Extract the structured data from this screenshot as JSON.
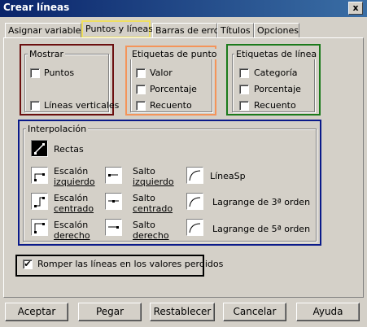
{
  "window": {
    "title": "Crear líneas",
    "close": "x"
  },
  "tabs": [
    "Asignar variables",
    "Puntos y líneas",
    "Barras de error",
    "Títulos",
    "Opciones"
  ],
  "mostrar": {
    "title": "Mostrar",
    "puntos": "Puntos",
    "lineas": "Líneas verticales"
  },
  "etiq_punto": {
    "title": "Etiquetas de punto",
    "valor": "Valor",
    "porcentaje": "Porcentaje",
    "recuento": "Recuento"
  },
  "etiq_linea": {
    "title": "Etiquetas de línea",
    "categoria": "Categoría",
    "porcentaje": "Porcentaje",
    "recuento": "Recuento"
  },
  "interp": {
    "title": "Interpolación",
    "rectas": "Rectas",
    "escalon_izq_1": "Escalón",
    "escalon_izq_2": "izquierdo",
    "escalon_cen_1": "Escalón",
    "escalon_cen_2": "centrado",
    "escalon_der_1": "Escalón",
    "escalon_der_2": "derecho",
    "salto_izq_1": "Salto",
    "salto_izq_2": "izquierdo",
    "salto_cen_1": "Salto",
    "salto_cen_2": "centrado",
    "salto_der_1": "Salto",
    "salto_der_2": "derecho",
    "lineasp": "LíneaSp",
    "lagrange3": "Lagrange de 3ª orden",
    "lagrange5": "Lagrange de 5ª orden"
  },
  "romper": {
    "label": "Romper las líneas en los valores perdidos",
    "checked": "✔"
  },
  "buttons": {
    "aceptar": "Aceptar",
    "pegar": "Pegar",
    "restablecer": "Restablecer",
    "cancelar": "Cancelar",
    "ayuda": "Ayuda"
  },
  "highlight_colors": {
    "tab": "#f0e060",
    "mostrar": "#6b0f0f",
    "etiq_punto": "#f4945a",
    "etiq_linea": "#1b7a1b",
    "interp": "#0a1a8a",
    "romper": "#000000"
  }
}
